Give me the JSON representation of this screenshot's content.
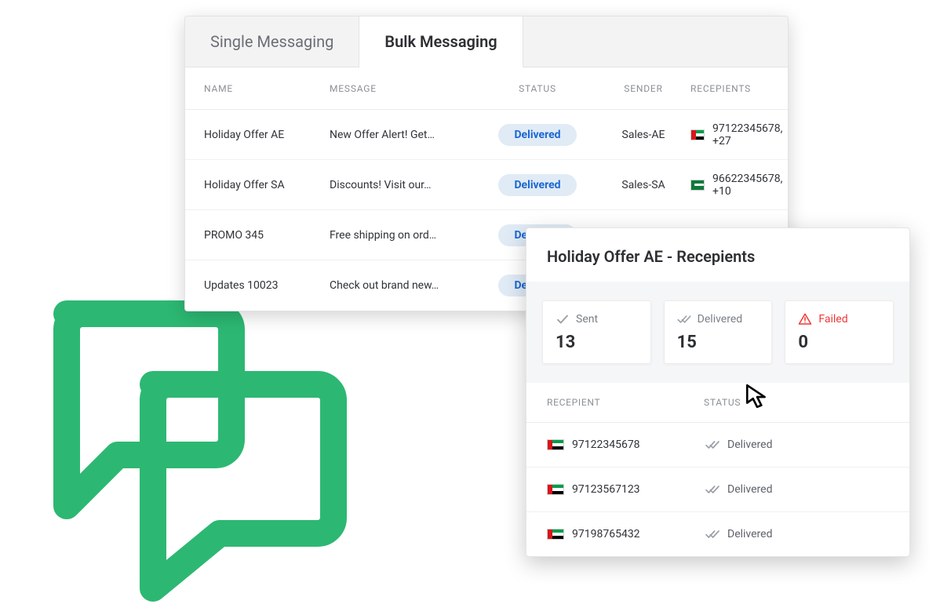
{
  "tabs": {
    "single": "Single Messaging",
    "bulk": "Bulk Messaging"
  },
  "headers": {
    "name": "NAME",
    "message": "MESSAGE",
    "status": "STATUS",
    "sender": "SENDER",
    "recipients": "RECEPIENTS"
  },
  "rows": [
    {
      "name": "Holiday Offer AE",
      "message": "New Offer Alert! Get…",
      "status": "Delivered",
      "sender": "Sales-AE",
      "flag": "ae",
      "recip": "97122345678, +27"
    },
    {
      "name": "Holiday Offer SA",
      "message": "Discounts! Visit our…",
      "status": "Delivered",
      "sender": "Sales-SA",
      "flag": "sa",
      "recip": "96622345678, +10"
    },
    {
      "name": "PROMO 345",
      "message": "Free shipping on ord…",
      "status": "Delivered",
      "sender": "",
      "flag": "",
      "recip": ""
    },
    {
      "name": "Updates 10023",
      "message": "Check out brand new…",
      "status": "Delivered",
      "sender": "",
      "flag": "",
      "recip": ""
    }
  ],
  "panel": {
    "title": "Holiday Offer AE - Recepients",
    "stats": {
      "sent": {
        "label": "Sent",
        "value": "13"
      },
      "delivered": {
        "label": "Delivered",
        "value": "15"
      },
      "failed": {
        "label": "Failed",
        "value": "0"
      }
    },
    "headers": {
      "recipient": "RECEPIENT",
      "status": "STATUS"
    },
    "rows": [
      {
        "flag": "ae",
        "num": "97122345678",
        "status": "Delivered"
      },
      {
        "flag": "ae",
        "num": "97123567123",
        "status": "Delivered"
      },
      {
        "flag": "ae",
        "num": "97198765432",
        "status": "Delivered"
      }
    ]
  }
}
